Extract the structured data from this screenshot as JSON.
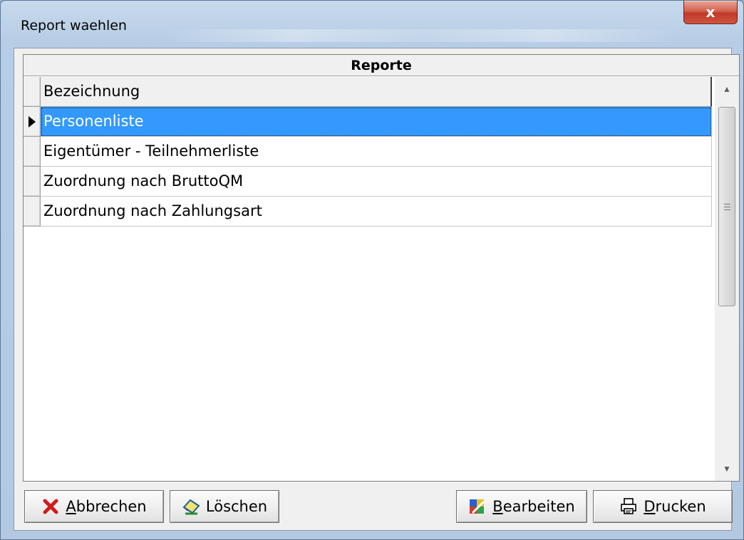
{
  "window": {
    "title": "Report waehlen",
    "close_glyph": "x"
  },
  "grid": {
    "caption": "Reporte",
    "column_header": "Bezeichnung",
    "rows": [
      {
        "label": "Personenliste",
        "selected": true
      },
      {
        "label": "Eigentümer - Teilnehmerliste",
        "selected": false
      },
      {
        "label": "Zuordnung nach BruttoQM",
        "selected": false
      },
      {
        "label": "Zuordnung nach Zahlungsart",
        "selected": false
      }
    ],
    "selection_color": "#3399ff"
  },
  "buttons": {
    "abbrechen": {
      "mnemonic": "A",
      "rest": "bbrechen",
      "icon": "red-x-icon"
    },
    "loeschen": {
      "label": "Löschen",
      "icon": "eraser-icon"
    },
    "bearbeiten": {
      "mnemonic": "B",
      "rest": "earbeiten",
      "icon": "edit-puzzle-icon"
    },
    "drucken": {
      "mnemonic": "D",
      "rest": "rucken",
      "icon": "printer-icon"
    }
  }
}
